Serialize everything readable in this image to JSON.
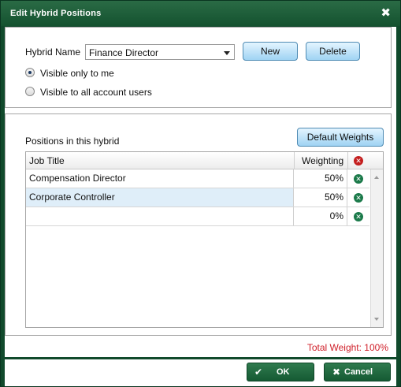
{
  "dialog": {
    "title": "Edit Hybrid Positions"
  },
  "hybrid": {
    "name_label": "Hybrid Name",
    "selected": "Finance Director",
    "new_label": "New",
    "delete_label": "Delete",
    "visibility_options": [
      {
        "label": "Visible only to me",
        "checked": true
      },
      {
        "label": "Visible to all account users",
        "checked": false
      }
    ]
  },
  "positions": {
    "section_label": "Positions in this hybrid",
    "default_weights_label": "Default Weights",
    "columns": {
      "job_title": "Job Title",
      "weighting": "Weighting"
    },
    "rows": [
      {
        "job_title": "Compensation Director",
        "weighting": "50%",
        "selected": false
      },
      {
        "job_title": "Corporate Controller",
        "weighting": "50%",
        "selected": true
      },
      {
        "job_title": "",
        "weighting": "0%",
        "selected": false
      }
    ],
    "total": "Total Weight: 100%"
  },
  "footer": {
    "ok_label": "OK",
    "cancel_label": "Cancel"
  },
  "colors": {
    "title_bar": "#14522f",
    "button_blue": "#9fd3f3",
    "button_green": "#155a33",
    "total_text": "#d0202a",
    "selected_row": "#dfeef9"
  },
  "icons": [
    "close-icon",
    "remove-icon",
    "checkmark-icon",
    "cancel-x-icon",
    "dropdown-arrow-icon"
  ]
}
